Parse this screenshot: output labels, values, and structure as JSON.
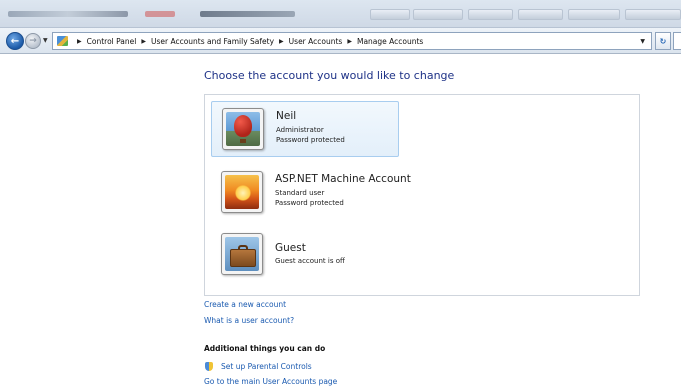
{
  "breadcrumb": {
    "items": [
      "Control Panel",
      "User Accounts and Family Safety",
      "User Accounts",
      "Manage Accounts"
    ]
  },
  "main": {
    "heading": "Choose the account you would like to change",
    "accounts": [
      {
        "name": "Neil",
        "line1": "Administrator",
        "line2": "Password protected",
        "picture": "hot-air-balloon",
        "selected": true
      },
      {
        "name": "ASP.NET Machine Account",
        "line1": "Standard user",
        "line2": "Password protected",
        "picture": "sunset",
        "selected": false
      },
      {
        "name": "Guest",
        "line1": "Guest account is off",
        "picture": "briefcase",
        "selected": false
      }
    ],
    "links": {
      "create_account": "Create a new account",
      "what_is": "What is a user account?"
    },
    "additional": {
      "title": "Additional things you can do",
      "parental": "Set up Parental Controls",
      "goto_main": "Go to the main User Accounts page"
    }
  },
  "icons": {
    "back": "back-arrow-icon",
    "forward": "forward-arrow-icon",
    "control_panel": "control-panel-icon",
    "refresh": "refresh-icon",
    "parental": "shield-icon"
  },
  "colors": {
    "heading": "#1e3287",
    "link": "#1a5ab0",
    "selected_bg": "#e3effa",
    "selected_border": "#a8cdef"
  }
}
